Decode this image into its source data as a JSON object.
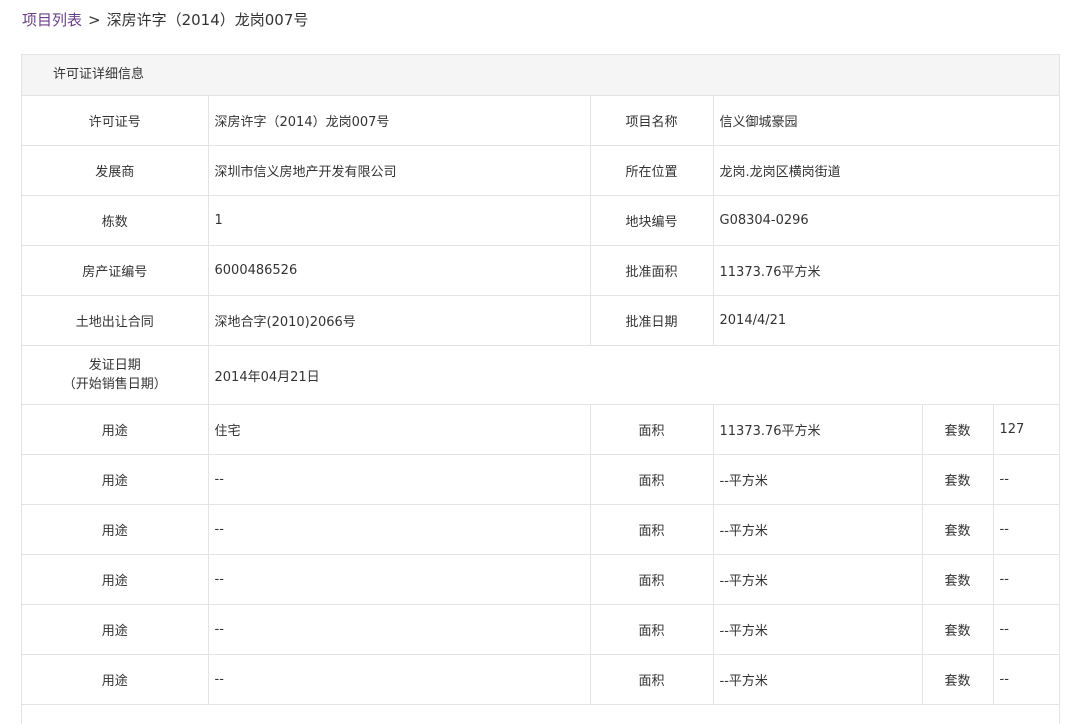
{
  "breadcrumb": {
    "link": "项目列表",
    "separator": ">",
    "current": "深房许字（2014）龙岗007号"
  },
  "panel": {
    "title": "许可证详细信息"
  },
  "details": {
    "permit_no_label": "许可证号",
    "permit_no": "深房许字（2014）龙岗007号",
    "project_name_label": "项目名称",
    "project_name": "信义御城豪园",
    "developer_label": "发展商",
    "developer": "深圳市信义房地产开发有限公司",
    "location_label": "所在位置",
    "location": "龙岗.龙岗区横岗街道",
    "buildings_label": "栋数",
    "buildings": "1",
    "plot_no_label": "地块编号",
    "plot_no": "G08304-0296",
    "property_cert_label": "房产证编号",
    "property_cert": "6000486526",
    "approved_area_label": "批准面积",
    "approved_area": "11373.76平方米",
    "land_contract_label": "土地出让合同",
    "land_contract": "深地合字(2010)2066号",
    "approval_date_label": "批准日期",
    "approval_date": "2014/4/21",
    "issue_date_label_1": "发证日期",
    "issue_date_label_2": "（开始销售日期）",
    "issue_date": "2014年04月21日"
  },
  "usage_rows": [
    {
      "use_label": "用途",
      "use": "住宅",
      "area_label": "面积",
      "area": "11373.76平方米",
      "units_label": "套数",
      "units": "127"
    },
    {
      "use_label": "用途",
      "use": "--",
      "area_label": "面积",
      "area": "--平方米",
      "units_label": "套数",
      "units": "--"
    },
    {
      "use_label": "用途",
      "use": "--",
      "area_label": "面积",
      "area": "--平方米",
      "units_label": "套数",
      "units": "--"
    },
    {
      "use_label": "用途",
      "use": "--",
      "area_label": "面积",
      "area": "--平方米",
      "units_label": "套数",
      "units": "--"
    },
    {
      "use_label": "用途",
      "use": "--",
      "area_label": "面积",
      "area": "--平方米",
      "units_label": "套数",
      "units": "--"
    },
    {
      "use_label": "用途",
      "use": "--",
      "area_label": "面积",
      "area": "--平方米",
      "units_label": "套数",
      "units": "--"
    }
  ],
  "colors": {
    "link": "#6b3e87",
    "border": "#e3e3e3",
    "header_bg": "#f5f5f5",
    "text": "#333333"
  }
}
